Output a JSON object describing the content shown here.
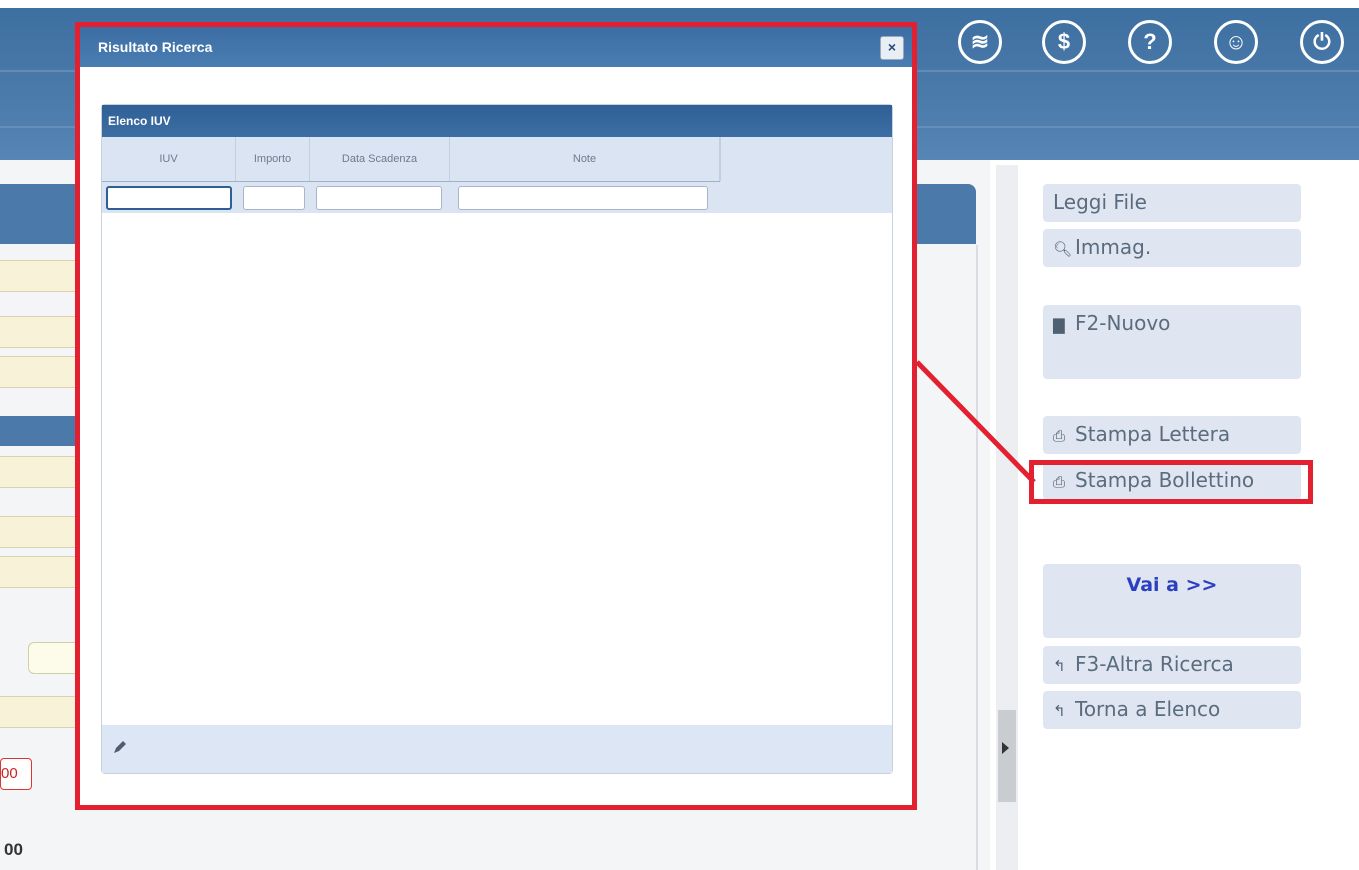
{
  "modal": {
    "title": "Risultato Ricerca",
    "close_label": "×",
    "grid": {
      "caption": "Elenco IUV",
      "columns": [
        "IUV",
        "Importo",
        "Data Scadenza",
        "Note"
      ],
      "filters": [
        "",
        "",
        "",
        ""
      ]
    }
  },
  "sidebar": {
    "leggi_file": "Leggi File",
    "immag": "Immag.",
    "nuovo": "F2-Nuovo",
    "stampa_lettera": "Stampa Lettera",
    "stampa_bollettino": "Stampa Bollettino",
    "vai_a": "Vai a >>",
    "altra_ricerca": "F3-Altra Ricerca",
    "torna_elenco": "Torna a Elenco"
  },
  "background": {
    "red_value": "00",
    "bold_value": "00"
  },
  "colors": {
    "header_blue": "#4a79aa",
    "highlight_red": "#e22030",
    "vai_a_blue": "#2b3fc1"
  },
  "icons": [
    "print-icon",
    "search-icon",
    "document-icon",
    "undo-icon",
    "pencil-icon",
    "close-icon"
  ]
}
